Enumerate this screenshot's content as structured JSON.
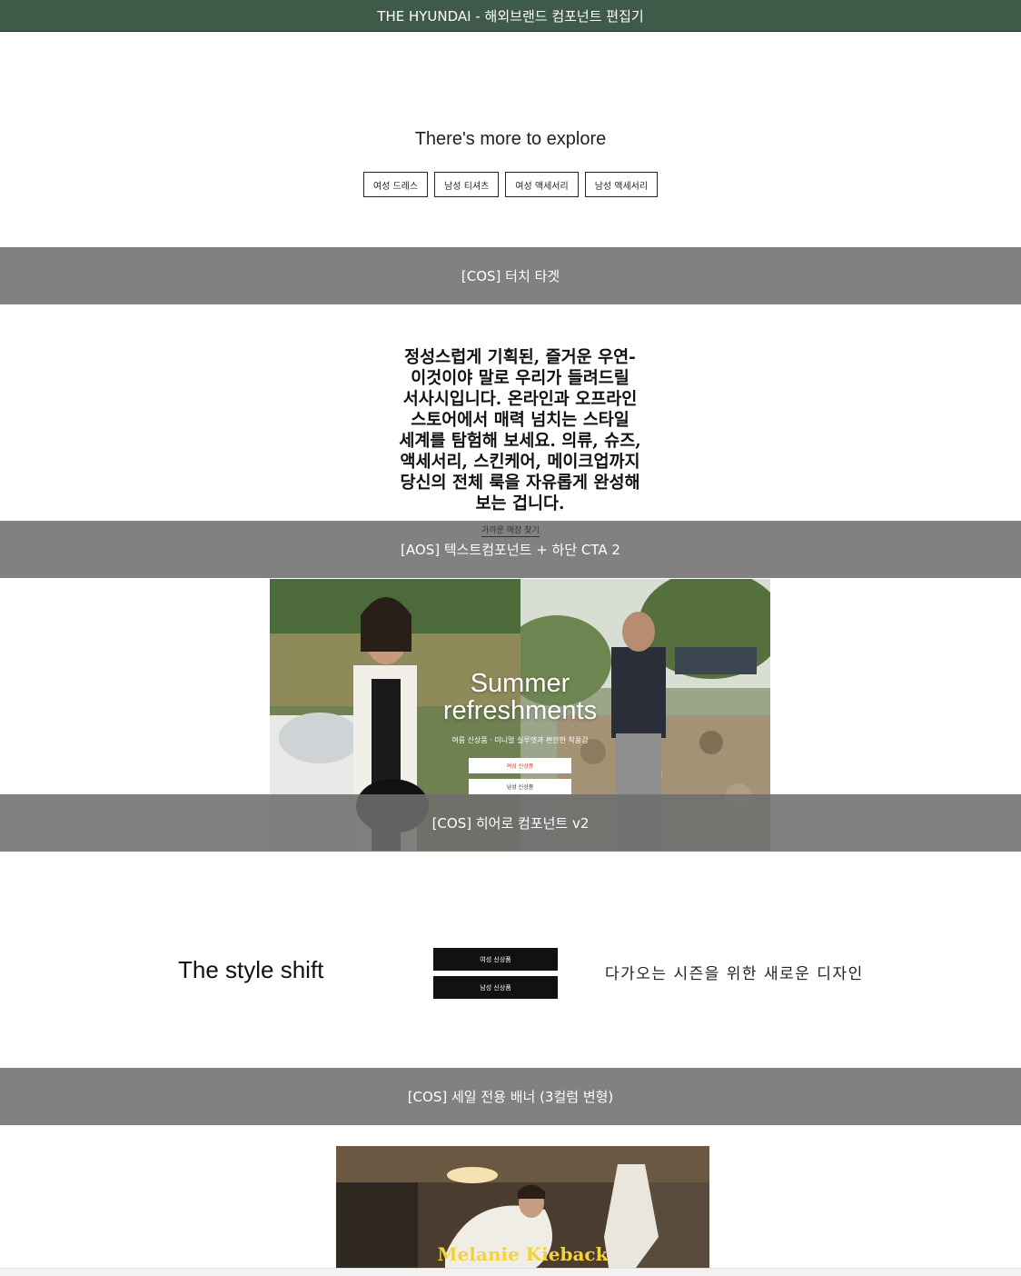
{
  "header": {
    "title": "THE HYUNDAI - 해외브랜드 컴포넌트 편집기"
  },
  "explore": {
    "title": "There's more to explore",
    "chips": [
      "여성 드레스",
      "남성 티셔츠",
      "여성 액세서리",
      "남성 액세서리"
    ]
  },
  "labels": {
    "touch_target": "[COS] 터치 타겟",
    "text_component": "[AOS] 텍스트컴포넌트 + 하단 CTA 2",
    "hero_component": "[COS] 히어로 컴포넌트 v2",
    "sale_banner": "[COS] 세일 전용 배너 (3컬럼 변형)"
  },
  "text_component": {
    "lines": [
      "정성스럽게 기획된, 즐거운 우연-",
      "이것이야 말로 우리가 들려드릴",
      "서사시입니다. 온라인과 오프라인",
      "스토어에서 매력 넘치는 스타일",
      "세계를 탐험해 보세요. 의류, 슈즈,",
      "액세서리, 스킨케어, 메이크업까지",
      "당신의 전체 룩을 자유롭게 완성해",
      "보는 겁니다."
    ],
    "cta": "가까운 매장 찾기"
  },
  "hero": {
    "title_line1": "Summer",
    "title_line2": "refreshments",
    "subtitle": "여름 신상품 · 미니멀 실루엣과 편안한 착용감",
    "buttons": [
      "여성 신상품",
      "남성 신상품"
    ]
  },
  "style_shift": {
    "title": "The style shift",
    "buttons": [
      "여성 신상품",
      "남성 신상품"
    ],
    "description": "다가오는 시즌을 위한 새로운 디자인"
  },
  "banner": {
    "name": "Melanie Kieback"
  },
  "colors": {
    "header_bg": "#3e5a49",
    "divider_bg": "#6e6e6e",
    "banner_text": "#f2d43a"
  }
}
